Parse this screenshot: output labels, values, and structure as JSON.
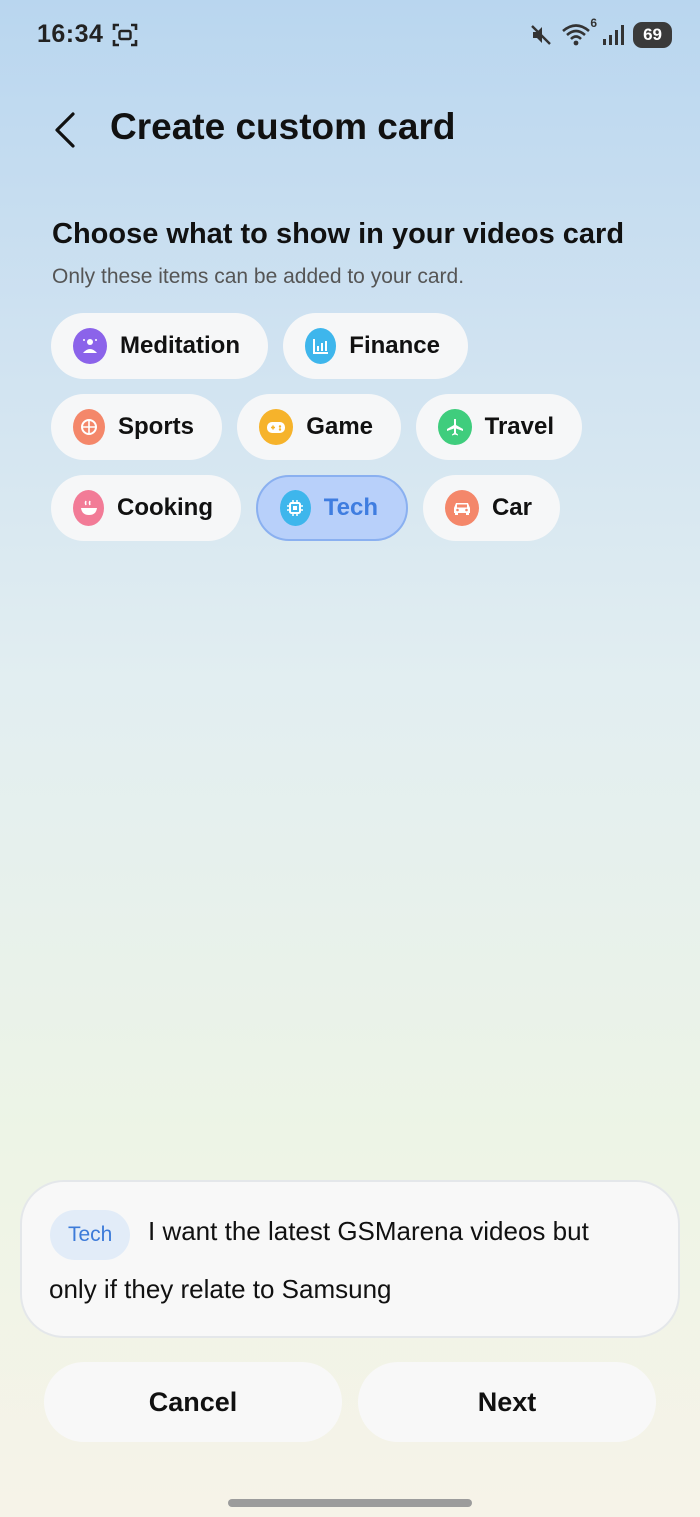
{
  "status_bar": {
    "time": "16:34",
    "battery": "69",
    "wifi_badge": "6"
  },
  "header": {
    "title": "Create custom card"
  },
  "section": {
    "title": "Choose what to show in your videos card",
    "subtitle": "Only these items can be added to your card."
  },
  "chips": {
    "meditation": {
      "label": "Meditation",
      "color": "#8b63ea"
    },
    "finance": {
      "label": "Finance",
      "color": "#3eb6ec"
    },
    "sports": {
      "label": "Sports",
      "color": "#f4876a"
    },
    "game": {
      "label": "Game",
      "color": "#f6b32b"
    },
    "travel": {
      "label": "Travel",
      "color": "#3fcd7d"
    },
    "cooking": {
      "label": "Cooking",
      "color": "#f27b97"
    },
    "tech": {
      "label": "Tech",
      "color": "#3eb6ec",
      "selected": true
    },
    "car": {
      "label": "Car",
      "color": "#f4876a"
    }
  },
  "prompt": {
    "tag": "Tech",
    "line1": "I want the latest GSMarena videos but",
    "line2": "only if they relate to Samsung"
  },
  "actions": {
    "cancel": "Cancel",
    "next": "Next"
  }
}
